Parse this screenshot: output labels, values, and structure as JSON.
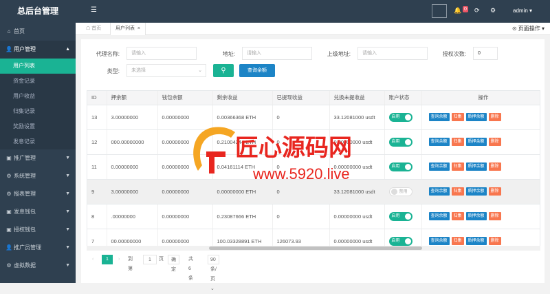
{
  "brand": "总后台管理",
  "sidebar": {
    "items": [
      {
        "label": "首页",
        "icon": "home-icon",
        "type": "nav"
      },
      {
        "label": "用户管理",
        "icon": "user-icon",
        "type": "nav-open"
      },
      {
        "label": "用户列表",
        "type": "sub-active"
      },
      {
        "label": "资金记录",
        "type": "sub"
      },
      {
        "label": "用户收益",
        "type": "sub"
      },
      {
        "label": "归集记录",
        "type": "sub"
      },
      {
        "label": "奖励设置",
        "type": "sub"
      },
      {
        "label": "发息记录",
        "type": "sub"
      },
      {
        "label": "推广管理",
        "icon": "folder-icon",
        "type": "nav"
      },
      {
        "label": "系统管理",
        "icon": "gear-icon",
        "type": "nav"
      },
      {
        "label": "报表管理",
        "icon": "gear-icon",
        "type": "nav"
      },
      {
        "label": "发息钱包",
        "icon": "folder-icon",
        "type": "nav"
      },
      {
        "label": "授权钱包",
        "icon": "folder-icon",
        "type": "nav"
      },
      {
        "label": "推广员管理",
        "icon": "user-icon",
        "type": "nav"
      },
      {
        "label": "虚拟数据",
        "icon": "gear-icon",
        "type": "nav"
      }
    ]
  },
  "topbar": {
    "badge": "0",
    "user": "admin"
  },
  "tabs": {
    "home": "首页",
    "current": "用户列表",
    "page_op": "页面操作"
  },
  "search": {
    "agent_label": "代理名称:",
    "agent_placeholder": "请输入",
    "address_label": "地址:",
    "address_placeholder": "请输入",
    "parent_label": "上级地址:",
    "parent_placeholder": "请输入",
    "auth_label": "授权次数:",
    "auth_value": "0",
    "type_label": "类型:",
    "type_placeholder": "未选择",
    "query_button": "查询余额"
  },
  "table": {
    "headers": [
      "ID",
      "押余额",
      "钱包余额",
      "剩余收益",
      "已提现收益",
      "兑换未提收益",
      "账户状态",
      "操作"
    ],
    "rows": [
      {
        "id": "13",
        "pledge": "3.00000000",
        "wallet": "0.00000000",
        "remain": "0.00366368 ETH",
        "withdrawn": "0",
        "exchange": "33.12081000 usdt",
        "status": "on"
      },
      {
        "id": "12",
        "pledge": "000.00000000",
        "wallet": "0.00000000",
        "remain": "0.21004244 ETH",
        "withdrawn": "0",
        "exchange": "0.00000000 usdt",
        "status": "on"
      },
      {
        "id": "11",
        "pledge": "0.00000000",
        "wallet": "0.00000000",
        "remain": "0.04161114 ETH",
        "withdrawn": "0",
        "exchange": "0.00000000 usdt",
        "status": "on"
      },
      {
        "id": "9",
        "pledge": "3.00000000",
        "wallet": "0.00000000",
        "remain": "0.00000000 ETH",
        "withdrawn": "0",
        "exchange": "33.12081000 usdt",
        "status": "off"
      },
      {
        "id": "8",
        "pledge": ".00000000",
        "wallet": "0.00000000",
        "remain": "0.23087666 ETH",
        "withdrawn": "0",
        "exchange": "0.00000000 usdt",
        "status": "on"
      },
      {
        "id": "7",
        "pledge": "00.00000000",
        "wallet": "0.00000000",
        "remain": "100.03328891 ETH",
        "withdrawn": "126073.93",
        "exchange": "0.00000000 usdt",
        "status": "on"
      }
    ],
    "status_on": "启用",
    "status_off": "禁用",
    "actions": [
      "查询余额",
      "归集",
      "质押余额",
      "删除"
    ]
  },
  "pager": {
    "current": "1",
    "goto": "到第",
    "page_input": "1",
    "page_unit": "页",
    "confirm": "确定",
    "total": "共 6 条",
    "per_page": "90 条/页"
  },
  "watermark": {
    "title": "匠心源码网",
    "url": "www.5920.live"
  }
}
